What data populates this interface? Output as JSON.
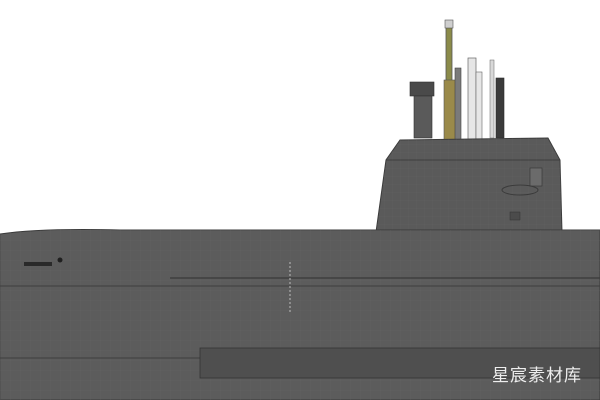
{
  "watermark": {
    "text": "星宸素材库"
  },
  "colors": {
    "background": "#ffffff",
    "hull": "#5c5c5c",
    "hull_dark": "#4f4f4f",
    "tower": "#5a5a5a",
    "grid": "#6a6a6a",
    "mast_olive": "#8b8b4a",
    "mast_light": "#e8e8e8"
  },
  "icons": [
    "submarine-hull",
    "conning-tower",
    "periscope-masts"
  ]
}
